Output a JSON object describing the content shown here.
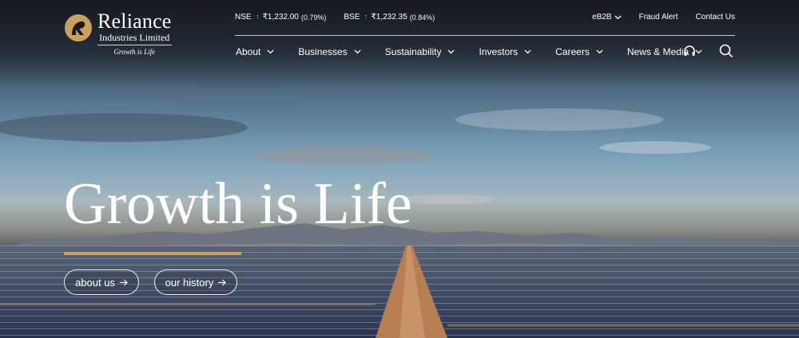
{
  "brand": {
    "name": "Reliance",
    "subtitle": "Industries Limited",
    "tagline": "Growth is Life",
    "logo_color": "#c8a15e"
  },
  "ticker": [
    {
      "exchange": "NSE",
      "price": "₹1,232.00",
      "change": "(0.79%)",
      "direction": "up"
    },
    {
      "exchange": "BSE",
      "price": "₹1,232.35",
      "change": "(0.84%)",
      "direction": "up"
    }
  ],
  "utility_links": [
    {
      "label": "eB2B",
      "has_dropdown": true
    },
    {
      "label": "Fraud Alert",
      "has_dropdown": false
    },
    {
      "label": "Contact Us",
      "has_dropdown": false
    }
  ],
  "nav": [
    {
      "label": "About"
    },
    {
      "label": "Businesses"
    },
    {
      "label": "Sustainability"
    },
    {
      "label": "Investors"
    },
    {
      "label": "Careers"
    },
    {
      "label": "News & Media"
    }
  ],
  "nav_icons": [
    "headphones-icon",
    "search-icon"
  ],
  "hero": {
    "headline": "Growth is Life",
    "accent_color": "#c8a15e",
    "buttons": [
      {
        "label": "about us",
        "icon": "arrow-right-icon"
      },
      {
        "label": "our history",
        "icon": "arrow-right-icon"
      }
    ]
  }
}
